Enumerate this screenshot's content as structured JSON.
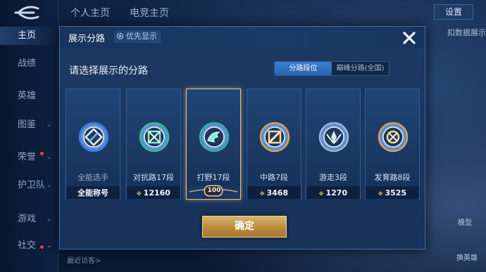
{
  "topbar": {
    "tabs": [
      "个人主页",
      "电竞主页"
    ],
    "settings_label": "设置"
  },
  "sidebar": {
    "items": [
      {
        "label": "主页",
        "active": true,
        "chevron": false
      },
      {
        "label": "战绩",
        "active": false,
        "chevron": false
      },
      {
        "label": "英雄",
        "active": false,
        "chevron": false
      },
      {
        "label": "图鉴",
        "active": false,
        "chevron": true
      },
      {
        "label": "荣誉",
        "active": false,
        "chevron": true
      },
      {
        "label": "护卫队",
        "active": false,
        "chevron": true
      },
      {
        "label": "游戏",
        "active": false,
        "chevron": true
      },
      {
        "label": "社交",
        "active": false,
        "chevron": true
      }
    ]
  },
  "right_strip": {
    "text": "扣数据展示",
    "icon_labels": [
      "模型",
      "换英雄"
    ]
  },
  "bottom_text": "最近访客>",
  "dialog": {
    "title": "展示分路",
    "priority_label": "优先显示",
    "prompt": "请选择展示的分路",
    "segments": [
      "分路段位",
      "巅峰分路(全国)"
    ],
    "active_segment": 0,
    "confirm_label": "确定",
    "cards": [
      {
        "name": "全能选手",
        "footer": "全能称号",
        "points": null,
        "selected": false,
        "emblem": "all-round-emblem-icon",
        "accent": "#3f7bd8"
      },
      {
        "name": "对抗路17段",
        "footer": "12160",
        "points": true,
        "selected": false,
        "emblem": "clash-lane-emblem-icon",
        "accent": "#3bbd8a"
      },
      {
        "name": "打野17段",
        "footer": "100",
        "points": false,
        "selected": true,
        "emblem": "jungle-emblem-icon",
        "accent": "#2fb39a"
      },
      {
        "name": "中路7段",
        "footer": "3468",
        "points": true,
        "selected": false,
        "emblem": "mid-lane-emblem-icon",
        "accent": "#d9a64a"
      },
      {
        "name": "游走3段",
        "footer": "1270",
        "points": true,
        "selected": false,
        "emblem": "roam-emblem-icon",
        "accent": "#9fb6cc"
      },
      {
        "name": "发育路8段",
        "footer": "3525",
        "points": true,
        "selected": false,
        "emblem": "farm-lane-emblem-icon",
        "accent": "#d9a64a"
      }
    ]
  }
}
